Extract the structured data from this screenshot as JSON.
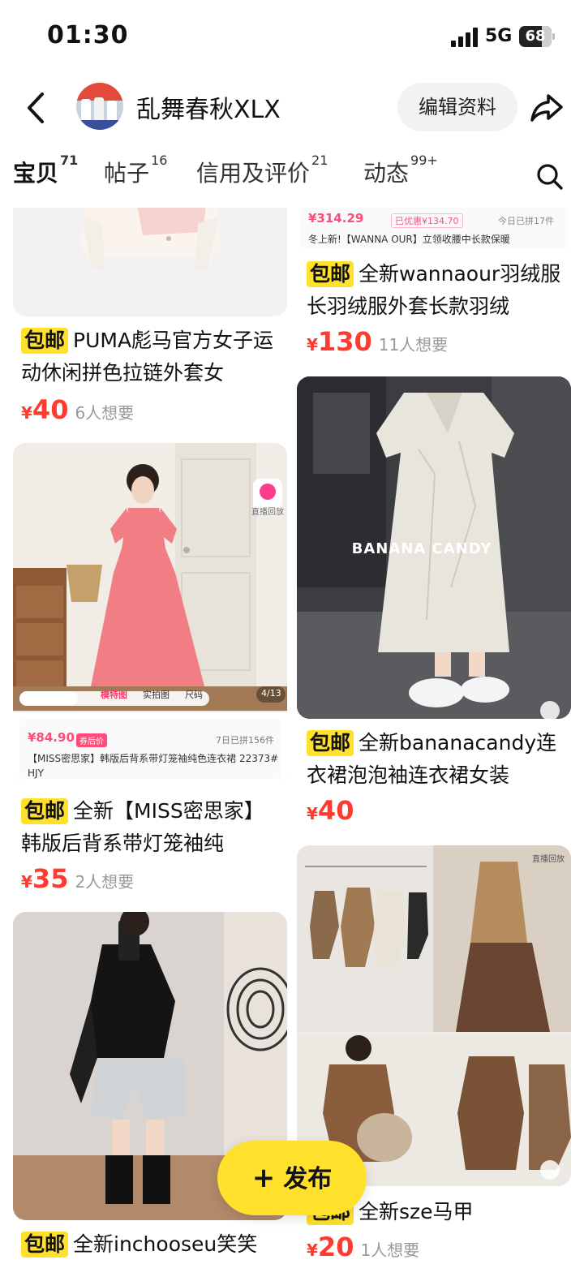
{
  "status_bar": {
    "time": "01:30",
    "network": "5G",
    "battery": "68"
  },
  "header": {
    "shop_name": "乱舞春秋XLX",
    "edit_label": "编辑资料"
  },
  "tabs": [
    {
      "label": "宝贝",
      "count": "71"
    },
    {
      "label": "帖子",
      "count": "16"
    },
    {
      "label": "信用及评价",
      "count": "21"
    },
    {
      "label": "动态",
      "count": "99+"
    }
  ],
  "items": {
    "puma": {
      "badge": "包邮",
      "title": "PUMA彪马官方女子运动休闲拼色拉链外套女",
      "currency": "¥",
      "price": "40",
      "wants": "6人想要"
    },
    "wanna": {
      "banner_price": "¥314.29",
      "banner_discount": "已优惠¥134.70",
      "banner_sold": "今日已拼17件",
      "banner_title": "冬上新!【WANNA OUR】立领收腰中长款保暖",
      "badge": "包邮",
      "title": "全新wannaour羽绒服长羽绒服外套长款羽绒",
      "currency": "¥",
      "price": "130",
      "wants": "11人想要"
    },
    "miss": {
      "replay_label": "直播回放",
      "tab_model": "模特图",
      "tab_real": "实拍图",
      "tab_size": "尺码",
      "pager": "4/13",
      "info_price": "¥84.90",
      "info_tag": "券后价",
      "info_sold": "7日已拼156件",
      "info_title": "【MISS密思家】韩版后背系带灯笼袖纯色连衣裙 22373# HJY",
      "badge": "包邮",
      "title": "全新【MISS密思家】韩版后背系带灯笼袖纯",
      "currency": "¥",
      "price": "35",
      "wants": "2人想要"
    },
    "banana": {
      "overlay": "BANANA CANDY",
      "badge": "包邮",
      "title": "全新bananacandy连衣裙泡泡袖连衣裙女装",
      "currency": "¥",
      "price": "40",
      "wants": ""
    },
    "sze": {
      "replay_label": "直播回放",
      "badge": "包邮",
      "title": "全新sze马甲",
      "currency": "¥",
      "price": "20",
      "wants": "1人想要"
    },
    "inchoose": {
      "badge": "包邮",
      "title": "全新inchooseu笑笑"
    }
  },
  "publish": {
    "label": "发布"
  },
  "colors": {
    "accent_yellow": "#ffe02b",
    "price_red": "#ff3b2f"
  }
}
